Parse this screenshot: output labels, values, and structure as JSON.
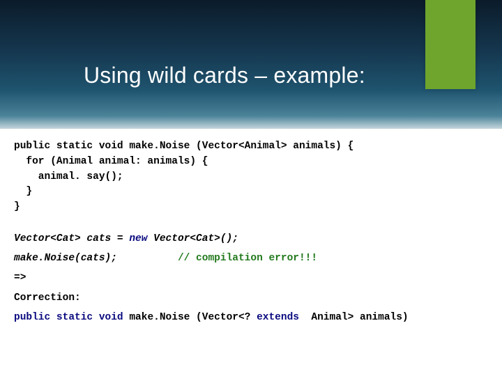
{
  "title": "Using wild cards – example:",
  "code_block1": "public static void make.Noise (Vector<Animal> animals) {\n  for (Animal animal: animals) {\n    animal. say();\n  }\n}",
  "block2": {
    "line1_a": "Vector<Cat> cats = ",
    "line1_new": "new",
    "line1_b": " Vector<Cat>();",
    "line2_a": "make.Noise(cats);",
    "line2_pad": "          ",
    "line2_comment": "// compilation error!!!",
    "arrow": "=>",
    "correction_label": "Correction:",
    "corr_a": "public static void",
    "corr_b": " make.Noise (Vector<? ",
    "corr_ext": "extends ",
    "corr_c": " Animal> animals)"
  }
}
